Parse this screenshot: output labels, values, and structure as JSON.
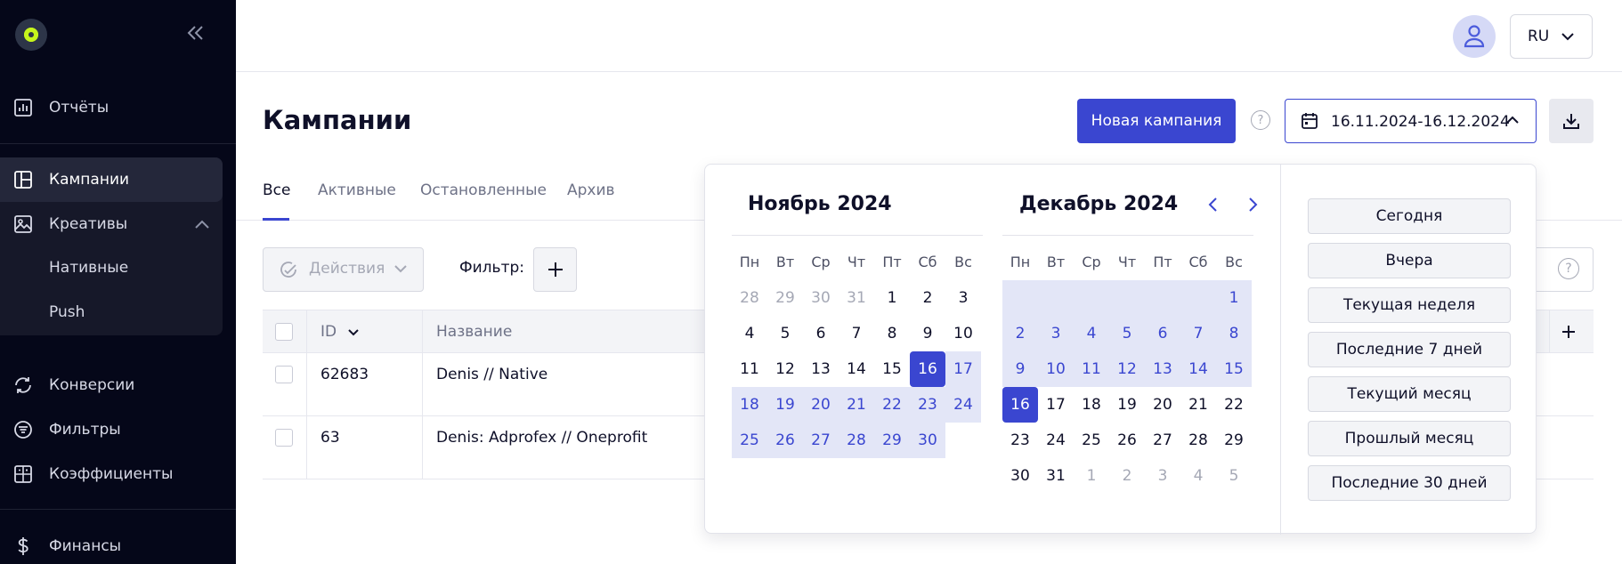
{
  "sidebar": {
    "collapse_icon": "double-chevron-left-icon",
    "items": {
      "reports": "Отчёты",
      "campaigns": "Кампании",
      "creatives": "Креативы",
      "native": "Нативные",
      "push": "Push",
      "conversions": "Конверсии",
      "filters": "Фильтры",
      "coefficients": "Коэффициенты",
      "finance": "Финансы"
    }
  },
  "header": {
    "language": "RU"
  },
  "page": {
    "title": "Кампании",
    "new_campaign": "Новая кампания",
    "help": "?",
    "date_range": "16.11.2024-16.12.2024"
  },
  "tabs": {
    "all": "Все",
    "active": "Активные",
    "stopped": "Остановленные",
    "archive": "Архив"
  },
  "toolbar": {
    "actions": "Действия",
    "filter_label": "Фильтр:",
    "help": "?"
  },
  "table": {
    "columns": {
      "id": "ID",
      "name": "Название"
    },
    "rows": [
      {
        "id": "62683",
        "name": "Denis // Native"
      },
      {
        "id": "63",
        "name": "Denis: Adprofex // Oneprofit"
      }
    ]
  },
  "datepicker": {
    "weekdays": [
      "Пн",
      "Вт",
      "Ср",
      "Чт",
      "Пт",
      "Сб",
      "Вс"
    ],
    "left_month": {
      "title": "Ноябрь 2024",
      "days": [
        {
          "d": "28",
          "s": "muted"
        },
        {
          "d": "29",
          "s": "muted"
        },
        {
          "d": "30",
          "s": "muted"
        },
        {
          "d": "31",
          "s": "muted"
        },
        {
          "d": "1",
          "s": ""
        },
        {
          "d": "2",
          "s": ""
        },
        {
          "d": "3",
          "s": ""
        },
        {
          "d": "4",
          "s": ""
        },
        {
          "d": "5",
          "s": ""
        },
        {
          "d": "6",
          "s": ""
        },
        {
          "d": "7",
          "s": ""
        },
        {
          "d": "8",
          "s": ""
        },
        {
          "d": "9",
          "s": ""
        },
        {
          "d": "10",
          "s": ""
        },
        {
          "d": "11",
          "s": ""
        },
        {
          "d": "12",
          "s": ""
        },
        {
          "d": "13",
          "s": ""
        },
        {
          "d": "14",
          "s": ""
        },
        {
          "d": "15",
          "s": ""
        },
        {
          "d": "16",
          "s": "selected"
        },
        {
          "d": "17",
          "s": "inrange"
        },
        {
          "d": "18",
          "s": "inrange"
        },
        {
          "d": "19",
          "s": "inrange"
        },
        {
          "d": "20",
          "s": "inrange"
        },
        {
          "d": "21",
          "s": "inrange"
        },
        {
          "d": "22",
          "s": "inrange"
        },
        {
          "d": "23",
          "s": "inrange"
        },
        {
          "d": "24",
          "s": "inrange"
        },
        {
          "d": "25",
          "s": "inrange"
        },
        {
          "d": "26",
          "s": "inrange"
        },
        {
          "d": "27",
          "s": "inrange"
        },
        {
          "d": "28",
          "s": "inrange"
        },
        {
          "d": "29",
          "s": "inrange"
        },
        {
          "d": "30",
          "s": "inrange"
        },
        {
          "d": "",
          "s": "empty"
        }
      ]
    },
    "right_month": {
      "title": "Декабрь 2024",
      "days": [
        {
          "d": "",
          "s": "inrange-empty"
        },
        {
          "d": "",
          "s": "inrange-empty"
        },
        {
          "d": "",
          "s": "inrange-empty"
        },
        {
          "d": "",
          "s": "inrange-empty"
        },
        {
          "d": "",
          "s": "inrange-empty"
        },
        {
          "d": "",
          "s": "inrange-empty"
        },
        {
          "d": "1",
          "s": "inrange"
        },
        {
          "d": "2",
          "s": "inrange"
        },
        {
          "d": "3",
          "s": "inrange"
        },
        {
          "d": "4",
          "s": "inrange"
        },
        {
          "d": "5",
          "s": "inrange"
        },
        {
          "d": "6",
          "s": "inrange"
        },
        {
          "d": "7",
          "s": "inrange"
        },
        {
          "d": "8",
          "s": "inrange"
        },
        {
          "d": "9",
          "s": "inrange"
        },
        {
          "d": "10",
          "s": "inrange"
        },
        {
          "d": "11",
          "s": "inrange"
        },
        {
          "d": "12",
          "s": "inrange"
        },
        {
          "d": "13",
          "s": "inrange"
        },
        {
          "d": "14",
          "s": "inrange"
        },
        {
          "d": "15",
          "s": "inrange"
        },
        {
          "d": "16",
          "s": "selected"
        },
        {
          "d": "17",
          "s": ""
        },
        {
          "d": "18",
          "s": ""
        },
        {
          "d": "19",
          "s": ""
        },
        {
          "d": "20",
          "s": ""
        },
        {
          "d": "21",
          "s": ""
        },
        {
          "d": "22",
          "s": ""
        },
        {
          "d": "23",
          "s": ""
        },
        {
          "d": "24",
          "s": ""
        },
        {
          "d": "25",
          "s": ""
        },
        {
          "d": "26",
          "s": ""
        },
        {
          "d": "27",
          "s": ""
        },
        {
          "d": "28",
          "s": ""
        },
        {
          "d": "29",
          "s": ""
        },
        {
          "d": "30",
          "s": ""
        },
        {
          "d": "31",
          "s": ""
        },
        {
          "d": "1",
          "s": "muted"
        },
        {
          "d": "2",
          "s": "muted"
        },
        {
          "d": "3",
          "s": "muted"
        },
        {
          "d": "4",
          "s": "muted"
        },
        {
          "d": "5",
          "s": "muted"
        }
      ]
    },
    "presets": [
      "Сегодня",
      "Вчера",
      "Текущая неделя",
      "Последние 7 дней",
      "Текущий месяц",
      "Прошлый месяц",
      "Последние 30 дней"
    ]
  },
  "colors": {
    "accent": "#3a46d0",
    "range": "#e3e6f7",
    "sidebar_bg": "#050719",
    "logo": "#c6f51c"
  }
}
